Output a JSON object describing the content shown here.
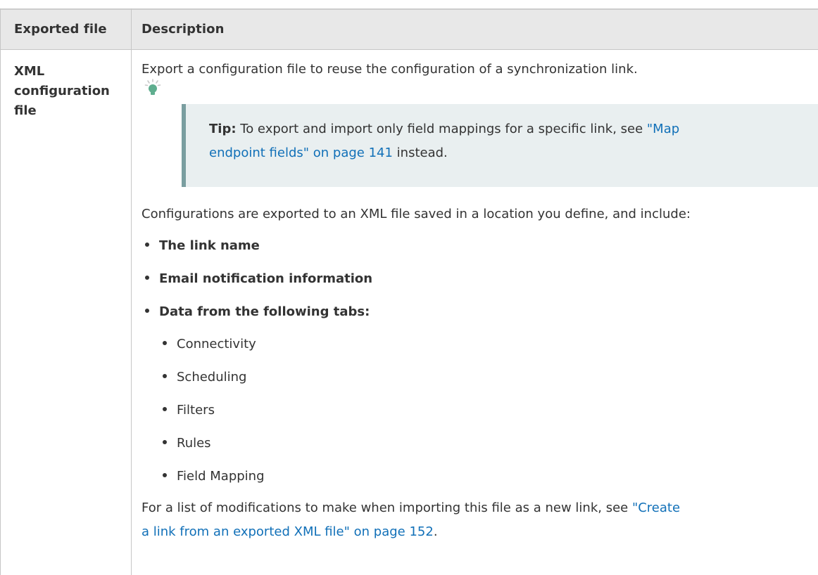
{
  "table": {
    "headers": [
      "Exported file",
      "Description"
    ],
    "row": {
      "file_label": "XML configuration file",
      "intro": "Export a configuration file to reuse the configuration of a synchronization link.",
      "tip": {
        "label": "Tip:",
        "text_before": "To export and import only field mappings for a specific link, see",
        "link_line1": "\"Map",
        "link_line2": "endpoint fields\" on page 141",
        "text_after": "instead."
      },
      "configs_intro": "Configurations are exported to an XML file saved in a location you define, and include:",
      "bullets": [
        "The link name",
        "Email notification information",
        "Data from the following tabs:"
      ],
      "sub_bullets": [
        "Connectivity",
        "Scheduling",
        "Filters",
        "Rules",
        "Field Mapping"
      ],
      "outro": {
        "text": "For a list of modifications to make when importing this file as a new link, see",
        "link_line1": "\"Create",
        "link_line2": "a link from an exported XML file\" on page 152",
        "end": "."
      }
    }
  },
  "icons": {
    "tip": "lightbulb-icon"
  },
  "colors": {
    "header_bg": "#e8e8e8",
    "tip_bg": "#e9eff0",
    "tip_border": "#7a9ea0",
    "link": "#1170b8",
    "text": "#333333"
  }
}
